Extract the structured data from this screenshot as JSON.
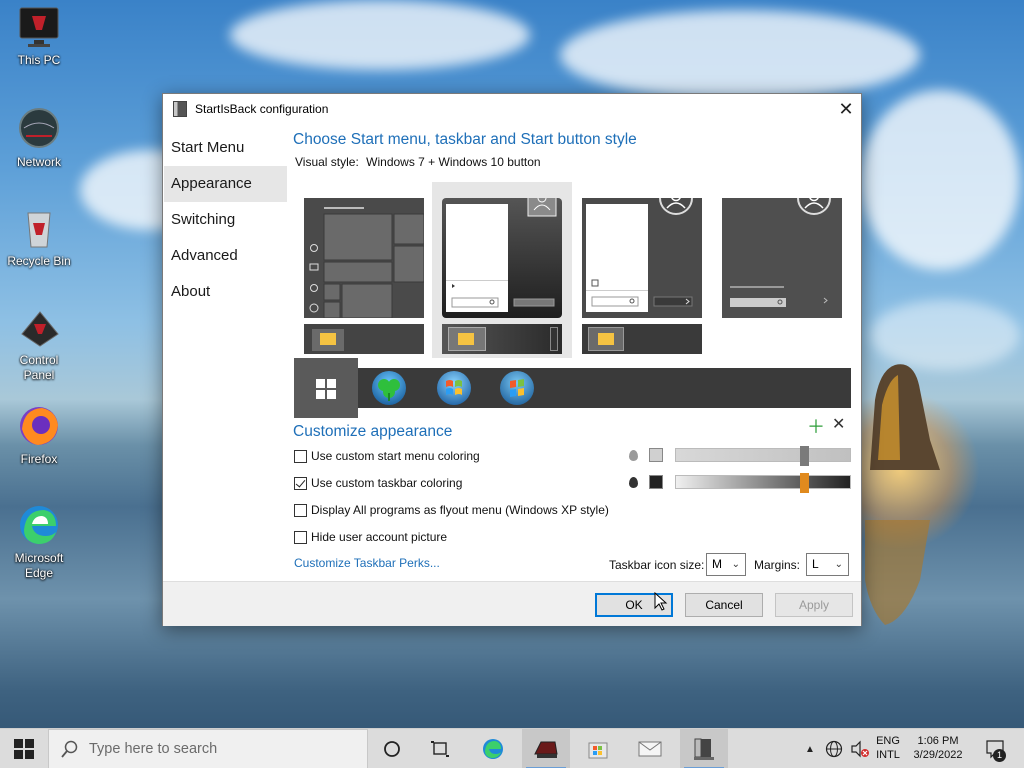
{
  "desktop": {
    "icons": [
      {
        "label": "This PC"
      },
      {
        "label": "Network"
      },
      {
        "label": "Recycle Bin"
      },
      {
        "label": "Control\nPanel",
        "label_line1": "Control",
        "label_line2": "Panel"
      },
      {
        "label": "Firefox"
      },
      {
        "label": "Microsoft Edge",
        "label_line1": "Microsoft",
        "label_line2": "Edge"
      }
    ]
  },
  "dialog": {
    "title": "StartIsBack configuration",
    "nav": [
      "Start Menu",
      "Appearance",
      "Switching",
      "Advanced",
      "About"
    ],
    "active_nav": "Appearance",
    "style_heading": "Choose Start menu, taskbar and Start button style",
    "visual_style_label": "Visual style:",
    "visual_style_value": "Windows 7 + Windows 10 button",
    "customize_heading": "Customize appearance",
    "options": [
      {
        "label": "Use custom start menu coloring",
        "checked": false
      },
      {
        "label": "Use custom taskbar coloring",
        "checked": true
      },
      {
        "label": "Display All programs as flyout menu (Windows XP style)",
        "checked": false
      },
      {
        "label": "Hide user account picture",
        "checked": false
      }
    ],
    "start_menu_color": "#d0d0d0",
    "taskbar_color": "#222222",
    "start_menu_slider_level": 0.75,
    "taskbar_slider_level": 0.75,
    "taskbar_perks_link": "Customize Taskbar Perks...",
    "icon_size_label": "Taskbar icon size:",
    "icon_size_value": "M",
    "margins_label": "Margins:",
    "margins_value": "L",
    "buttons": {
      "ok": "OK",
      "cancel": "Cancel",
      "apply": "Apply"
    },
    "accent": "#1e6fb8"
  },
  "taskbar": {
    "search_placeholder": "Type here to search",
    "language_line1": "ENG",
    "language_line2": "INTL",
    "time": "1:06 PM",
    "date": "3/29/2022",
    "notification_count": "1"
  }
}
